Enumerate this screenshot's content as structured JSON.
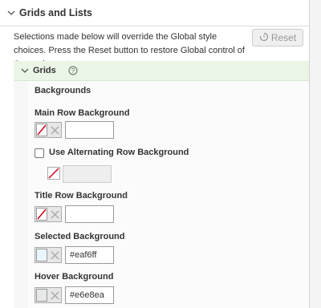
{
  "section": {
    "title": "Grids and Lists"
  },
  "description": "Selections made below will override the Global style choices. Press the Reset button to restore Global control of these elements.",
  "reset_button": {
    "label": "Reset",
    "icon": "reset-icon"
  },
  "subsection": {
    "title": "Grids",
    "help_icon": "question-circle-icon"
  },
  "backgrounds_heading": "Backgrounds",
  "fields": {
    "main_row": {
      "label": "Main Row Background",
      "value": ""
    },
    "alternating": {
      "label": "Use Alternating Row Background",
      "checked": false,
      "value": ""
    },
    "title_row": {
      "label": "Title Row Background",
      "value": ""
    },
    "selected": {
      "label": "Selected Background",
      "value": "#eaf6ff",
      "swatch_color": "#eaf6ff"
    },
    "hover": {
      "label": "Hover Background",
      "value": "#e6e8ea",
      "swatch_color": "#e6e8ea"
    }
  },
  "colors": {
    "accent_green": "#eaf5e6",
    "none_slash": "#d0021b"
  }
}
